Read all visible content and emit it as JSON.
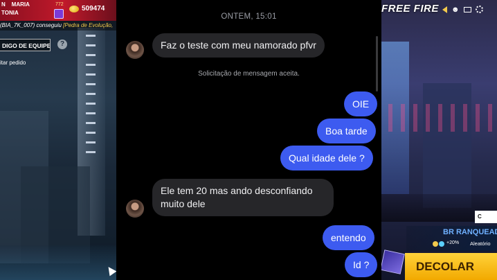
{
  "left_game": {
    "player_name_1": "N",
    "player_name_2": "MARIA",
    "player_name_3": "TONIA",
    "level_text": "772",
    "coins": "509474",
    "ticker_prefix": "(BIA_7K_007) conseguiu ",
    "ticker_highlight": "[Pedra de Evolução,",
    "team_code_label": "DIGO DE EQUIPE",
    "help_glyph": "?",
    "accept_request": "itar pedido"
  },
  "right_game": {
    "logo": "FREE FIRE",
    "small_button": "C",
    "mode_label": "BR RANQUEADO",
    "bonus": "+20%",
    "random": "Aleatório",
    "start_button": "DECOLAR"
  },
  "chat": {
    "timestamp": "ONTEM, 15:01",
    "system_notice": "Solicitação de mensagem aceita.",
    "messages": [
      {
        "from": "them",
        "text": "Faz o teste com meu namorado pfvr"
      },
      {
        "from": "me",
        "text": "OIE"
      },
      {
        "from": "me",
        "text": "Boa tarde"
      },
      {
        "from": "me",
        "text": "Qual idade dele ?"
      },
      {
        "from": "them",
        "text": "Ele tem 20 mas ando desconfiando muito dele"
      },
      {
        "from": "me",
        "text": "entendo"
      },
      {
        "from": "me",
        "text": "Id ?"
      }
    ]
  },
  "colors": {
    "outgoing_bubble": "#3d5bf0",
    "incoming_bubble": "#262629",
    "chat_background": "#000000",
    "hud_red": "#c1192b",
    "decolar_yellow": "#f2a900"
  }
}
